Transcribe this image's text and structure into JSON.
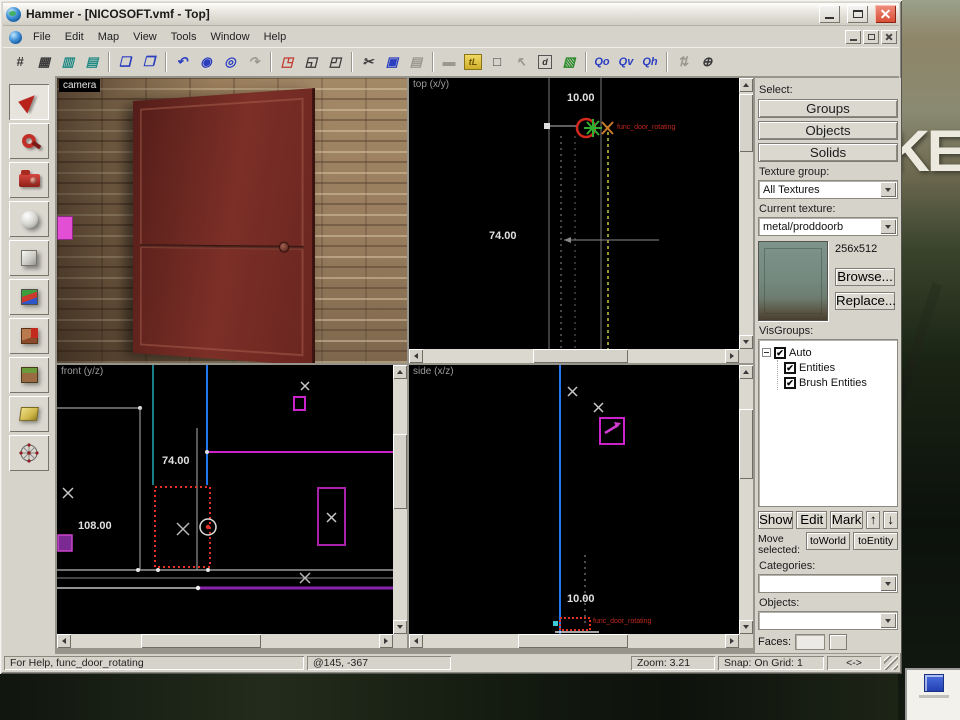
{
  "window": {
    "title": "Hammer - [NICOSOFT.vmf - Top]"
  },
  "menu": {
    "items": [
      "File",
      "Edit",
      "Map",
      "View",
      "Tools",
      "Window",
      "Help"
    ]
  },
  "toolbar": {
    "icons": [
      {
        "name": "toggle-grid",
        "glyph": "#"
      },
      {
        "name": "toggle-3d-grid",
        "glyph": "▦"
      },
      {
        "name": "smaller-grid",
        "glyph": "▥"
      },
      {
        "name": "larger-grid",
        "glyph": "▤"
      },
      {
        "name": "load-window-state",
        "glyph": "❏"
      },
      {
        "name": "save-window-state",
        "glyph": "❐"
      },
      {
        "name": "undo",
        "glyph": "↶"
      },
      {
        "name": "toggle-models",
        "glyph": "◉"
      },
      {
        "name": "toggle-helpers",
        "glyph": "◎"
      },
      {
        "name": "redo",
        "glyph": "↷"
      },
      {
        "name": "ignore-groups",
        "glyph": "◳"
      },
      {
        "name": "group",
        "glyph": "◱"
      },
      {
        "name": "ungroup",
        "glyph": "◰"
      },
      {
        "name": "cut",
        "glyph": "✂"
      },
      {
        "name": "copy",
        "glyph": "▣"
      },
      {
        "name": "paste",
        "glyph": "▤"
      },
      {
        "name": "cordon",
        "glyph": "▬"
      },
      {
        "name": "texture-lock",
        "glyph": "tL"
      },
      {
        "name": "select-box",
        "glyph": "□"
      },
      {
        "name": "pointer",
        "glyph": "↖"
      },
      {
        "name": "toggle-detail",
        "glyph": "d"
      },
      {
        "name": "texture-application",
        "glyph": "▧"
      },
      {
        "name": "visgroup-world",
        "glyph": "Qo"
      },
      {
        "name": "visgroup-view",
        "glyph": "Qv"
      },
      {
        "name": "visgroup-hide",
        "glyph": "Qh"
      },
      {
        "name": "flip",
        "glyph": "⇅"
      },
      {
        "name": "run-map",
        "glyph": "⊕"
      }
    ]
  },
  "left_toolbar": {
    "tools": [
      "selection-tool",
      "magnify-tool",
      "camera-tool",
      "entity-tool",
      "block-tool",
      "texture-application-tool",
      "apply-current-texture-tool",
      "overlay-tool",
      "clipping-tool",
      "vertex-tool"
    ]
  },
  "viewports": {
    "camera": {
      "label": "camera"
    },
    "top": {
      "label": "top (x/y)",
      "width_dim": "10.00",
      "height_dim": "74.00",
      "entity_label": "func_door_rotating"
    },
    "front": {
      "label": "front (y/z)",
      "height_dim": "74.00",
      "width_dim": "108.00"
    },
    "side": {
      "label": "side (x/z)",
      "width_dim": "10.00",
      "entity_label": "func_door_rotating"
    }
  },
  "right_panel": {
    "select_label": "Select:",
    "select_buttons": [
      "Groups",
      "Objects",
      "Solids"
    ],
    "texture_group_label": "Texture group:",
    "texture_group_value": "All Textures",
    "current_texture_label": "Current texture:",
    "current_texture_value": "metal/proddoorb",
    "texture_size": "256x512",
    "browse_label": "Browse...",
    "replace_label": "Replace...",
    "visgroups_label": "VisGroups:",
    "visgroup_items": [
      {
        "label": "Auto",
        "checked": "✔"
      },
      {
        "label": "Entities",
        "checked": "✔"
      },
      {
        "label": "Brush Entities",
        "checked": "✔"
      }
    ],
    "show_label": "Show",
    "edit_label": "Edit",
    "mark_label": "Mark",
    "up_glyph": "↑",
    "down_glyph": "↓",
    "move_selected_label": "Move selected:",
    "to_world_label": "toWorld",
    "to_entity_label": "toEntity",
    "categories_label": "Categories:",
    "objects_label": "Objects:",
    "faces_label": "Faces:"
  },
  "status_bar": {
    "help": "For Help, func_door_rotating",
    "coords": "@145, -367",
    "zoom": "Zoom: 3.21",
    "snap": "Snap: On Grid: 1",
    "size_indicator": "<->"
  },
  "desktop": {
    "wallpaper_text": "KE"
  },
  "colors": {
    "chrome": "#d6d3cb",
    "selection_red": "#e53224",
    "grid_magenta": "#cc22cc",
    "axis_blue": "#2277ee",
    "axis_teal": "#1b7f8a",
    "dashed_yellow": "#cccc33",
    "entity_label_red": "#c0281e",
    "close_button_red": "#d84a33"
  }
}
